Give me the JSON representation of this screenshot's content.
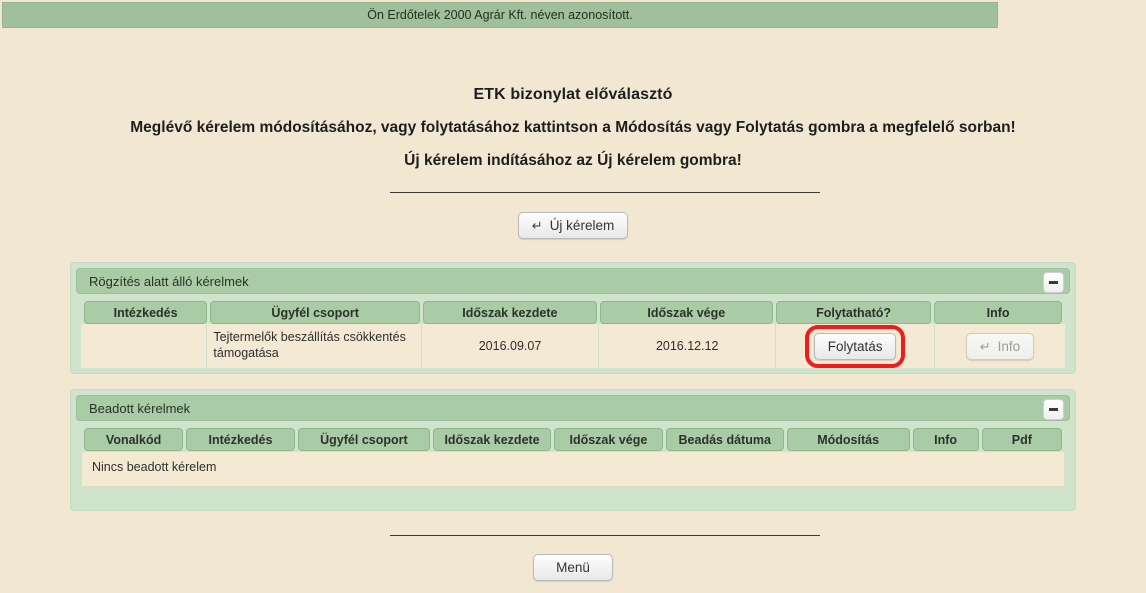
{
  "banner": {
    "text": "Ön Erdőtelek 2000 Agrár Kft. néven azonosított."
  },
  "headings": {
    "title": "ETK bizonylat előválasztó",
    "line1": "Meglévő kérelem módosításához, vagy folytatásához kattintson a Módosítás vagy Folytatás gombra a megfelelő sorban!",
    "line2": "Új kérelem indításához az Új kérelem gombra!"
  },
  "actions": {
    "new_request_label": "Új kérelem",
    "new_request_icon": "arrow-hook-icon",
    "menu_label": "Menü"
  },
  "panels": [
    {
      "id": "recording",
      "title": "Rögzítés alatt álló kérelmek",
      "collapse_icon": "minus-icon",
      "columns": [
        "Intézkedés",
        "Ügyfél csoport",
        "Időszak kezdete",
        "Időszak vége",
        "Folytatható?",
        "Info"
      ],
      "rows": [
        {
          "intezkedes": "",
          "ugyfel_csoport": "Tejtermelők beszállítás csökkentés támogatása",
          "idoszak_kezdete": "2016.09.07",
          "idoszak_vege": "2016.12.12",
          "folytathato_label": "Folytatás",
          "info_label": "Info",
          "info_icon": "arrow-hook-icon",
          "info_disabled": true,
          "highlighted": true,
          "highlight_color": "#ee1c1c"
        }
      ]
    },
    {
      "id": "submitted",
      "title": "Beadott kérelmek",
      "collapse_icon": "minus-icon",
      "columns": [
        "Vonalkód",
        "Intézkedés",
        "Ügyfél csoport",
        "Időszak kezdete",
        "Időszak vége",
        "Beadás dátuma",
        "Módosítás",
        "Info",
        "Pdf"
      ],
      "empty_message": "Nincs beadott kérelem"
    }
  ],
  "colors": {
    "page_background": "#f2e8d1",
    "banner_green": "#9fc09a",
    "panel_body_green": "#cfe3cd",
    "panel_header_green": "#a9cba5",
    "cell_cream": "#f4e9d2",
    "highlight_red": "#ee1c1c"
  }
}
